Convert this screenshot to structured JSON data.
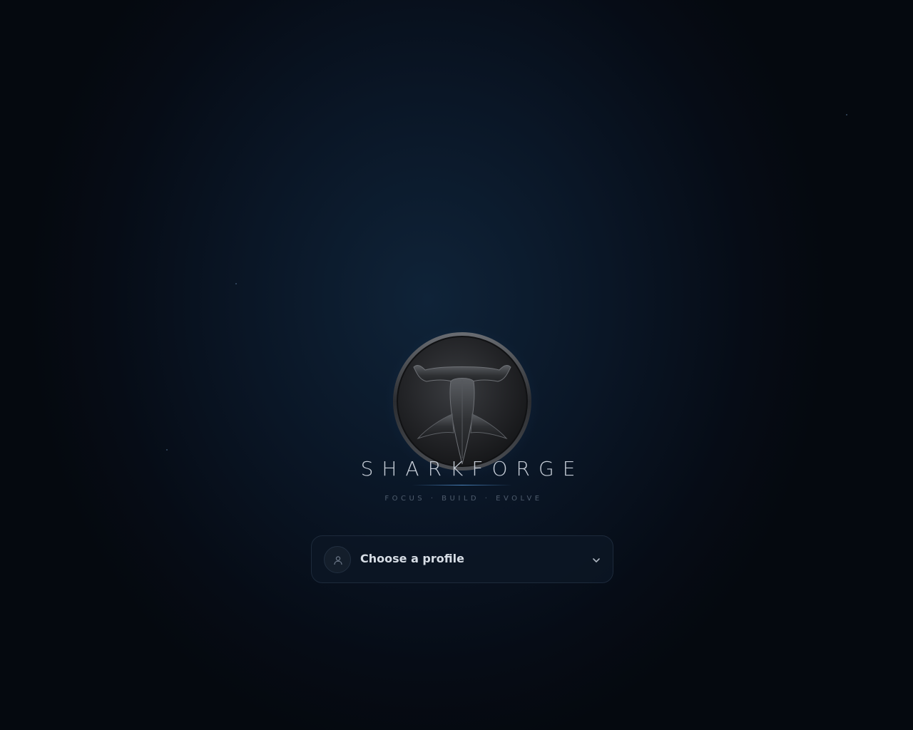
{
  "brand": {
    "name": "SHARKFORGE",
    "tagline": "FOCUS · BUILD · EVOLVE"
  },
  "profile_select": {
    "label": "Choose a profile",
    "avatar_icon": "user-icon",
    "dropdown_icon": "chevron-down-icon"
  },
  "colors": {
    "background": "#060c16",
    "accent": "#4a8fd0",
    "text_primary": "#d7dde5",
    "text_muted": "#4f5d6e"
  }
}
